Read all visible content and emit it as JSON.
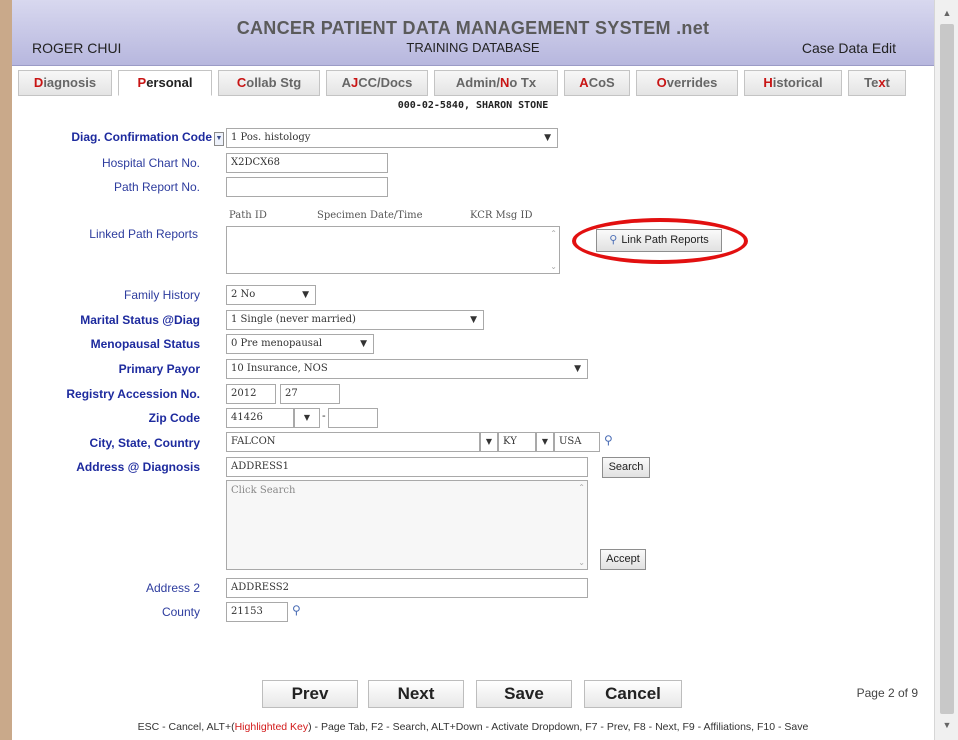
{
  "header": {
    "app_title": "CANCER PATIENT DATA MANAGEMENT SYSTEM .net",
    "user": "ROGER CHUI",
    "database": "TRAINING DATABASE",
    "mode": "Case Data Edit"
  },
  "tabs": [
    {
      "hotkey": "D",
      "rest": "iagnosis"
    },
    {
      "hotkey": "P",
      "rest": "ersonal"
    },
    {
      "hotkey": "C",
      "rest": "ollab Stg"
    },
    {
      "pre": "A",
      "hotkey": "J",
      "rest": "CC/Docs"
    },
    {
      "pre": "Admin/",
      "hotkey": "N",
      "rest": "o Tx"
    },
    {
      "hotkey": "A",
      "rest": "CoS"
    },
    {
      "hotkey": "O",
      "rest": "verrides"
    },
    {
      "hotkey": "H",
      "rest": "istorical"
    },
    {
      "pre": "Te",
      "hotkey": "x",
      "rest": "t"
    }
  ],
  "case_id": "000-02-5840, SHARON STONE",
  "fields": {
    "diag_confirmation": {
      "label": "Diag. Confirmation Code",
      "value": "1 Pos. histology"
    },
    "hospital_chart": {
      "label": "Hospital Chart No.",
      "value": "X2DCX68"
    },
    "path_report": {
      "label": "Path Report No.",
      "value": ""
    },
    "linked_path": {
      "label": "Linked Path Reports",
      "col_path_id": "Path ID",
      "col_specimen": "Specimen Date/Time",
      "col_kcr": "KCR Msg ID",
      "button": "Link Path Reports"
    },
    "family_history": {
      "label": "Family History",
      "value": "2 No"
    },
    "marital_status": {
      "label": "Marital Status @Diag",
      "value": "1 Single (never married)"
    },
    "menopausal": {
      "label": "Menopausal Status",
      "value": "0 Pre menopausal"
    },
    "primary_payor": {
      "label": "Primary Payor",
      "value": "10 Insurance, NOS"
    },
    "accession": {
      "label": "Registry Accession No.",
      "year": "2012",
      "number": "27"
    },
    "zip": {
      "label": "Zip Code",
      "value": "41426",
      "ext": ""
    },
    "city_state": {
      "label": "City, State, Country",
      "city": "FALCON",
      "state": "KY",
      "country": "USA"
    },
    "address": {
      "label": "Address @ Diagnosis",
      "value": "ADDRESS1",
      "search_button": "Search",
      "results_placeholder": "Click Search",
      "accept_button": "Accept"
    },
    "address2": {
      "label": "Address 2",
      "value": "ADDRESS2"
    },
    "county": {
      "label": "County",
      "value": "21153"
    }
  },
  "nav": {
    "prev": "Prev",
    "next": "Next",
    "save": "Save",
    "cancel": "Cancel",
    "page": "Page 2 of 9"
  },
  "hotkeys": {
    "pre": "ESC - Cancel, ALT+(",
    "highlight": "Highlighted Key",
    "post": ") - Page Tab, F2 - Search, ALT+Down - Activate Dropdown, F7 - Prev, F8 - Next, F9 - Affiliations, F10 - Save"
  },
  "colors": {
    "required_label": "#1d2a9e",
    "hotkey": "#c81414",
    "banner": "#c0c0e4",
    "highlight_ring": "#e21010"
  }
}
